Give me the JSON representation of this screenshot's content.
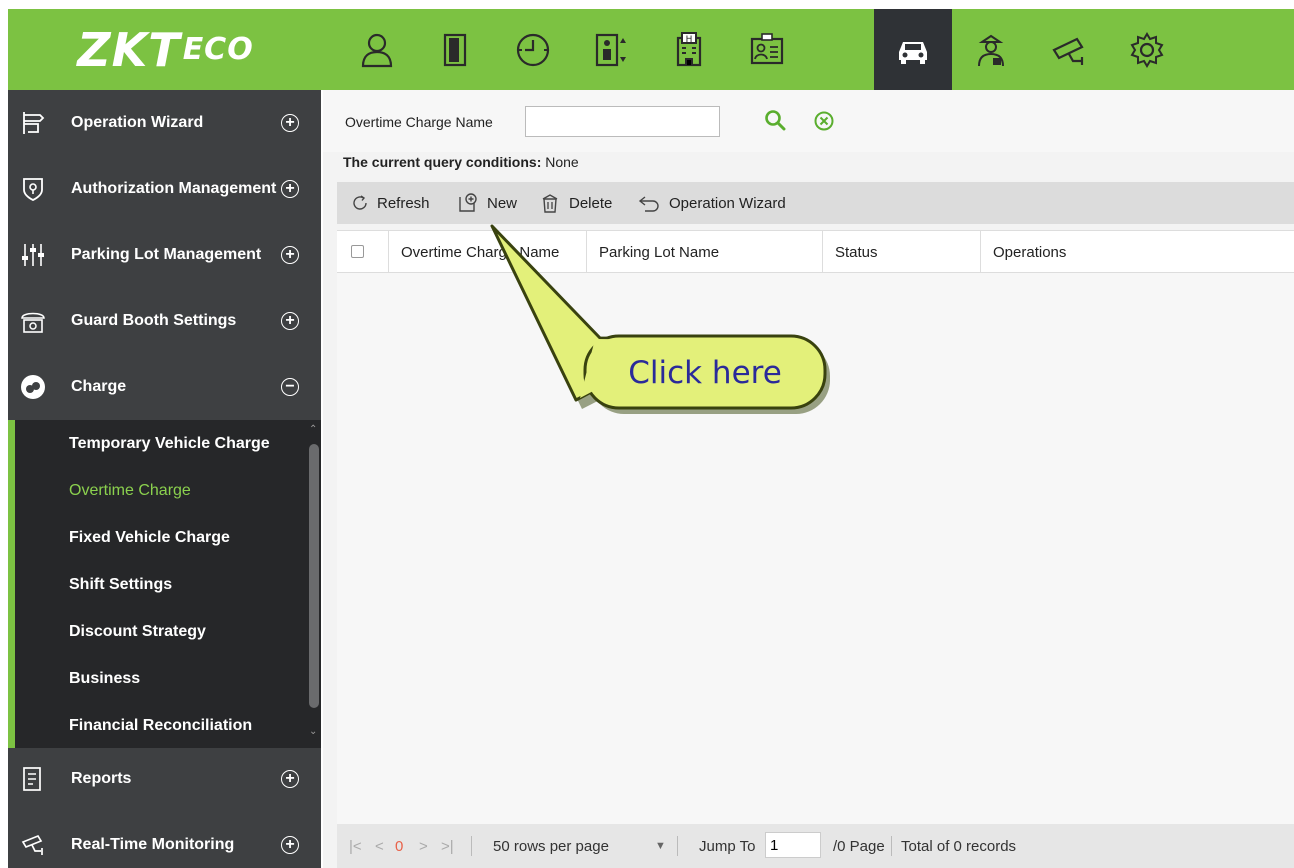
{
  "logo": {
    "big": "ZKT",
    "small": "ECO"
  },
  "top_modules": [
    {
      "icon": "personnel-icon"
    },
    {
      "icon": "access-door-icon"
    },
    {
      "icon": "attendance-clock-icon"
    },
    {
      "icon": "elevator-icon"
    },
    {
      "icon": "hotel-building-icon"
    },
    {
      "icon": "visitor-card-icon"
    },
    {
      "icon": "parking-car-icon",
      "active": true
    },
    {
      "icon": "patrol-guard-icon"
    },
    {
      "icon": "video-camera-icon"
    },
    {
      "icon": "system-settings-icon"
    }
  ],
  "sidebar": {
    "menus": [
      {
        "label": "Operation Wizard",
        "icon": "wizard-signpost-icon",
        "toggle": "+"
      },
      {
        "label": "Authorization Management",
        "icon": "authorization-shield-icon",
        "toggle": "+"
      },
      {
        "label": "Parking Lot Management",
        "icon": "parking-sliders-icon",
        "toggle": "+"
      },
      {
        "label": "Guard Booth Settings",
        "icon": "guard-booth-icon",
        "toggle": "+"
      },
      {
        "label": "Charge",
        "icon": "charge-coins-icon",
        "toggle": "−"
      },
      {
        "label": "Reports",
        "icon": "reports-doc-icon",
        "toggle": "+"
      },
      {
        "label": "Real-Time Monitoring",
        "icon": "monitoring-camera-icon",
        "toggle": "+"
      }
    ],
    "submenu": [
      {
        "label": "Temporary Vehicle Charge"
      },
      {
        "label": "Overtime Charge",
        "active": true
      },
      {
        "label": "Fixed Vehicle Charge"
      },
      {
        "label": "Shift Settings"
      },
      {
        "label": "Discount Strategy"
      },
      {
        "label": "Business"
      },
      {
        "label": "Financial Reconciliation"
      }
    ]
  },
  "search": {
    "label": "Overtime Charge Name",
    "value": ""
  },
  "query_conditions": {
    "label": "The current query conditions:",
    "value": "None"
  },
  "toolbar": {
    "refresh": "Refresh",
    "new": "New",
    "delete": "Delete",
    "wizard": "Operation Wizard"
  },
  "table": {
    "columns": [
      "Overtime Charge Name",
      "Parking Lot Name",
      "Status",
      "Operations"
    ],
    "rows": []
  },
  "pager": {
    "current_page": "0",
    "rows_per_page": "50 rows per page",
    "jump_to": "Jump To",
    "jump_value": "1",
    "page_total": "/0 Page",
    "records": "Total of 0 records"
  },
  "callout": {
    "text": "Click here"
  },
  "colors": {
    "brand_green": "#7cc242",
    "sidebar_dark": "#3e4042",
    "submenu_dark": "#262729",
    "active_green": "#8bd14e",
    "callout_fill": "#e3f07a"
  }
}
